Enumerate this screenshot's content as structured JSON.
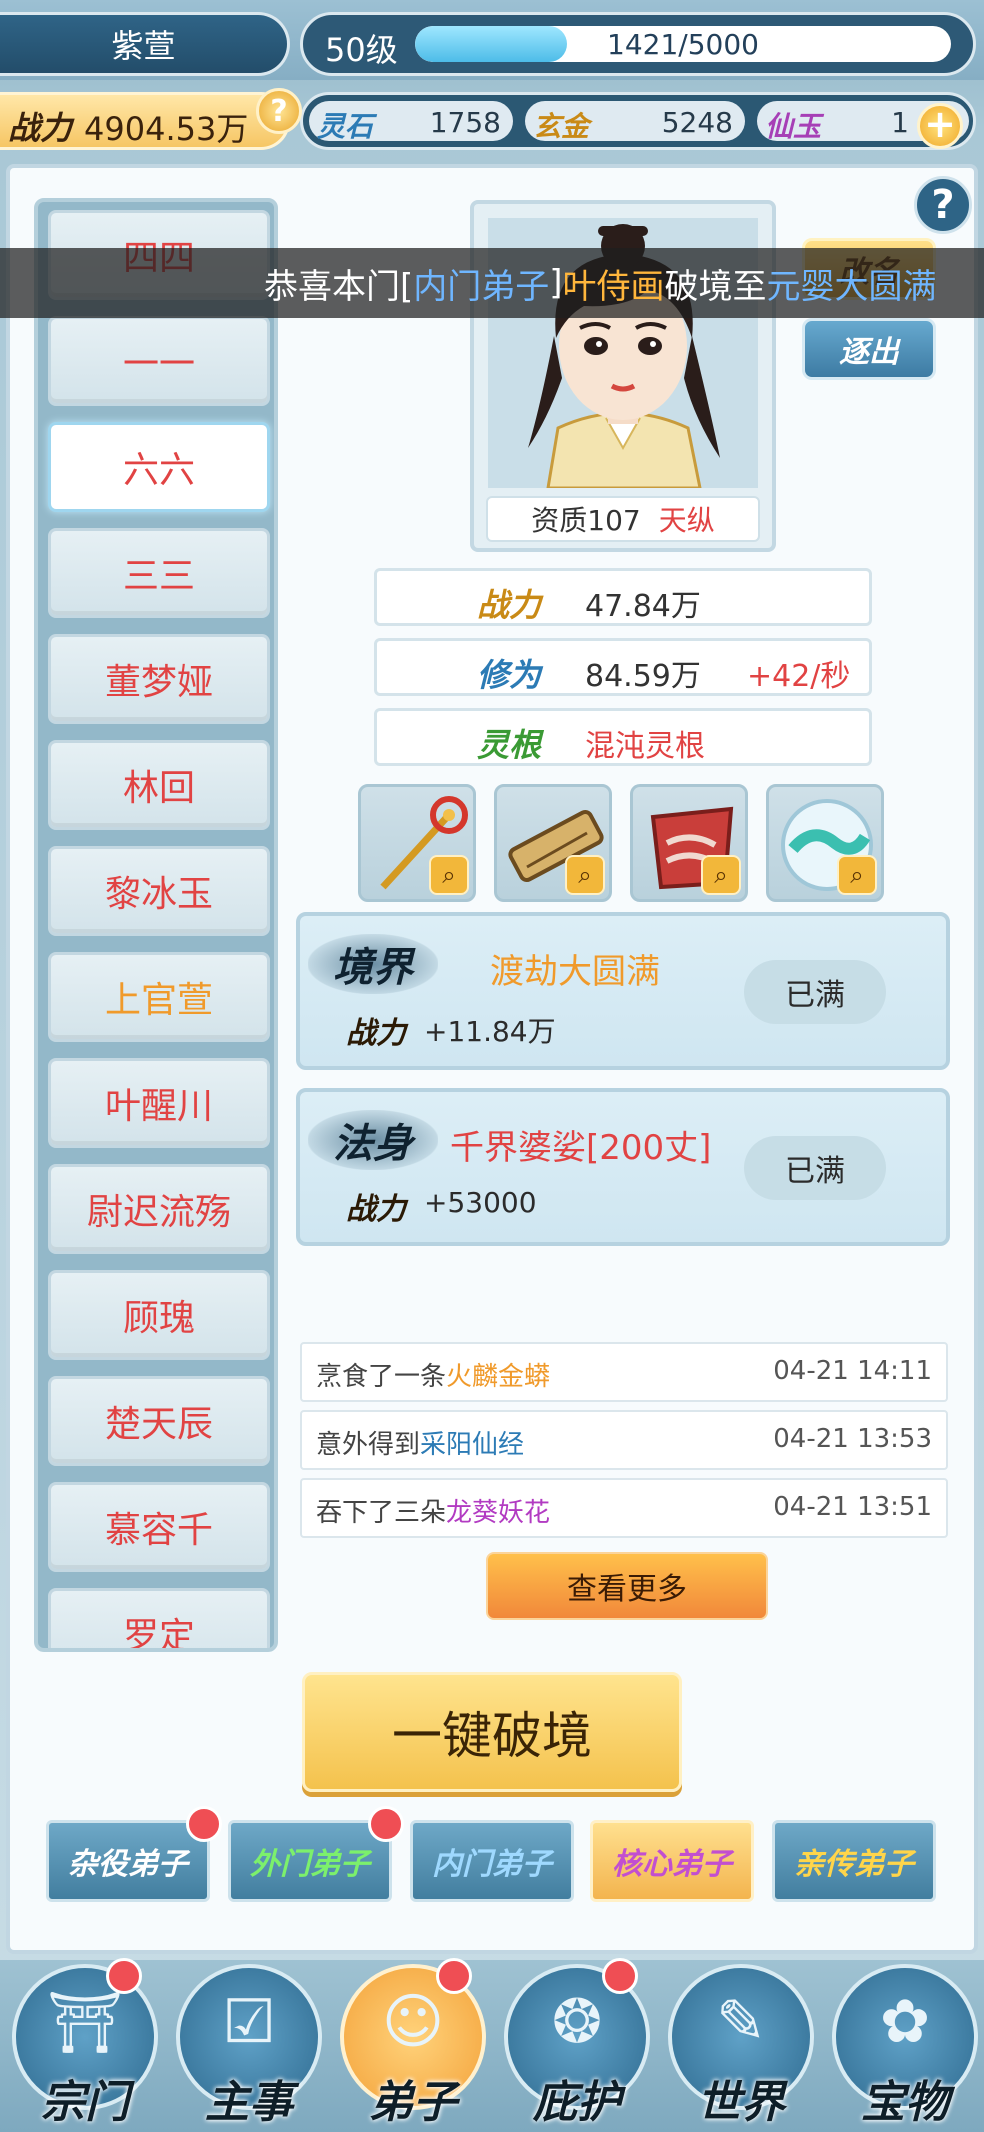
{
  "header": {
    "player_name": "紫萱",
    "level": "50级",
    "exp_text": "1421/5000",
    "exp_fraction": 0.284,
    "combat_power_label": "战力",
    "combat_power": "4904.53万",
    "help_icon": "?",
    "resources": [
      {
        "label": "灵石",
        "value": "1758",
        "color": "#2c7bb5"
      },
      {
        "label": "玄金",
        "value": "5248",
        "color": "#c98a16"
      },
      {
        "label": "仙玉",
        "value": "1",
        "color": "#a63fb6"
      }
    ],
    "plus_icon": "+"
  },
  "notice": {
    "prefix": "恭喜本门[",
    "rank": "内门弟子",
    "mid": "]",
    "name": "叶侍画",
    "action": "破境至",
    "realm": "元婴大圆满"
  },
  "disciple_list": [
    {
      "name": "四四",
      "color": "#e14343"
    },
    {
      "name": "一一",
      "color": "#e14343"
    },
    {
      "name": "六六",
      "color": "#e14343"
    },
    {
      "name": "三三",
      "color": "#e14343"
    },
    {
      "name": "董梦娅",
      "color": "#e14343"
    },
    {
      "name": "林回",
      "color": "#e14343"
    },
    {
      "name": "黎冰玉",
      "color": "#e14343"
    },
    {
      "name": "上官萱",
      "color": "#f09a2b"
    },
    {
      "name": "叶醒川",
      "color": "#e14343"
    },
    {
      "name": "尉迟流殇",
      "color": "#e14343"
    },
    {
      "name": "顾瑰",
      "color": "#e14343"
    },
    {
      "name": "楚天辰",
      "color": "#e14343"
    },
    {
      "name": "慕容千",
      "color": "#e14343"
    },
    {
      "name": "罗定",
      "color": "#e14343"
    }
  ],
  "disciple": {
    "aptitude_label": "资质107",
    "aptitude_rank": "天纵",
    "side_buttons": [
      "改名",
      "逐出"
    ],
    "stats": [
      {
        "label": "战力",
        "value": "47.84万",
        "extra": "",
        "label_color": "#c98a16"
      },
      {
        "label": "修为",
        "value": "84.59万",
        "extra": "+42/秒",
        "label_color": "#2c7bb5"
      },
      {
        "label": "灵根",
        "value": "混沌灵根",
        "extra": "",
        "label_color": "#3a9a34"
      }
    ],
    "equipment": [
      "staff-icon",
      "scroll-icon",
      "robe-icon",
      "orb-icon"
    ],
    "realm": {
      "badge": "境界",
      "name": "渡劫大圆满",
      "power_label": "战力",
      "power_value": "+11.84万",
      "status": "已满"
    },
    "dharma_body": {
      "badge": "法身",
      "name": "千界婆娑[200丈]",
      "power_label": "战力",
      "power_value": "+53000",
      "status": "已满"
    }
  },
  "logs": [
    {
      "prefix": "烹食了一条",
      "item": "火麟金蟒",
      "item_color": "#f09a2b",
      "time": "04-21 14:11"
    },
    {
      "prefix": "意外得到",
      "item": "采阳仙经",
      "item_color": "#2c7bb5",
      "time": "04-21 13:53"
    },
    {
      "prefix": "吞下了三朵",
      "item": "龙葵妖花",
      "item_color": "#b23bc2",
      "time": "04-21 13:51"
    }
  ],
  "more_button": "查看更多",
  "breakthrough_button": "一键破境",
  "categories": [
    {
      "label": "杂役弟子",
      "color": "#ffffff",
      "badge": true
    },
    {
      "label": "外门弟子",
      "color": "#7cf06c",
      "badge": true
    },
    {
      "label": "内门弟子",
      "color": "#9fd9ff",
      "badge": false
    },
    {
      "label": "核心弟子",
      "color": "#c24fd0",
      "badge": false
    },
    {
      "label": "亲传弟子",
      "color": "#ffd54a",
      "badge": false
    }
  ],
  "bottom_nav": [
    {
      "label": "宗门",
      "icon": "sect-icon",
      "glyph": "⛩",
      "badge": true
    },
    {
      "label": "主事",
      "icon": "checklist-icon",
      "glyph": "☑",
      "badge": false
    },
    {
      "label": "弟子",
      "icon": "disciple-icon",
      "glyph": "☺",
      "badge": true
    },
    {
      "label": "庇护",
      "icon": "shield-icon",
      "glyph": "❂",
      "badge": true
    },
    {
      "label": "世界",
      "icon": "scroll-icon",
      "glyph": "✎",
      "badge": false
    },
    {
      "label": "宝物",
      "icon": "treasure-bag-icon",
      "glyph": "✿",
      "badge": false
    }
  ]
}
